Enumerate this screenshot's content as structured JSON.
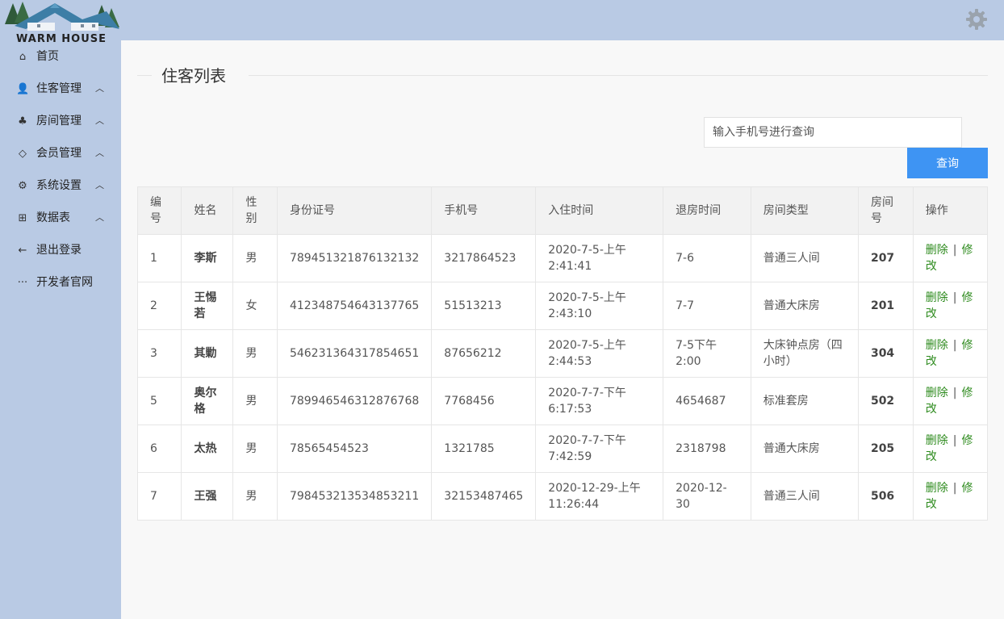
{
  "logo": {
    "text": "WARM HOUSE"
  },
  "icons": {
    "settings": "gear-icon"
  },
  "sidebar": {
    "items": [
      {
        "label": "首页",
        "icon": "home-icon",
        "expandable": false
      },
      {
        "label": "住客管理",
        "icon": "user-icon",
        "expandable": true
      },
      {
        "label": "房间管理",
        "icon": "palm-icon",
        "expandable": true
      },
      {
        "label": "会员管理",
        "icon": "diamond-icon",
        "expandable": true
      },
      {
        "label": "系统设置",
        "icon": "gear-icon",
        "expandable": true
      },
      {
        "label": "数据表",
        "icon": "table-icon",
        "expandable": true
      },
      {
        "label": "退出登录",
        "icon": "arrow-left-icon",
        "expandable": false
      },
      {
        "label": "开发者官网",
        "icon": "more-icon",
        "expandable": false
      }
    ]
  },
  "main": {
    "title": "住客列表",
    "search": {
      "placeholder": "输入手机号进行查询",
      "value": "",
      "button": "查询"
    },
    "table": {
      "headers": [
        "编号",
        "姓名",
        "性别",
        "身份证号",
        "手机号",
        "入住时间",
        "退房时间",
        "房间类型",
        "房间号",
        "操作"
      ],
      "rows": [
        {
          "id": "1",
          "name": "李斯",
          "gender": "男",
          "idcard": "789451321876132132",
          "phone": "3217864523",
          "checkin": "2020-7-5-上午2:41:41",
          "checkout": "7-6",
          "roomtype": "普通三人间",
          "room": "207"
        },
        {
          "id": "2",
          "name": "王惕若",
          "gender": "女",
          "idcard": "412348754643137765",
          "phone": "51513213",
          "checkin": "2020-7-5-上午2:43:10",
          "checkout": "7-7",
          "roomtype": "普通大床房",
          "room": "201"
        },
        {
          "id": "3",
          "name": "其勦",
          "gender": "男",
          "idcard": "546231364317854651",
          "phone": "87656212",
          "checkin": "2020-7-5-上午2:44:53",
          "checkout": "7-5下午2:00",
          "roomtype": "大床钟点房（四小时）",
          "room": "304"
        },
        {
          "id": "5",
          "name": "奥尔格",
          "gender": "男",
          "idcard": "789946546312876768",
          "phone": "7768456",
          "checkin": "2020-7-7-下午6:17:53",
          "checkout": "4654687",
          "roomtype": "标准套房",
          "room": "502"
        },
        {
          "id": "6",
          "name": "太热",
          "gender": "男",
          "idcard": "78565454523",
          "phone": "1321785",
          "checkin": "2020-7-7-下午7:42:59",
          "checkout": "2318798",
          "roomtype": "普通大床房",
          "room": "205"
        },
        {
          "id": "7",
          "name": "王强",
          "gender": "男",
          "idcard": "798453213534853211",
          "phone": "32153487465",
          "checkin": "2020-12-29-上午11:26:44",
          "checkout": "2020-12-30",
          "roomtype": "普通三人间",
          "room": "506"
        }
      ],
      "actions": {
        "delete": "删除",
        "separator": "|",
        "edit": "修改"
      }
    }
  },
  "colors": {
    "sidebar": "#b9cae4",
    "accent": "#3e94f3",
    "link": "#2e8b1e"
  }
}
